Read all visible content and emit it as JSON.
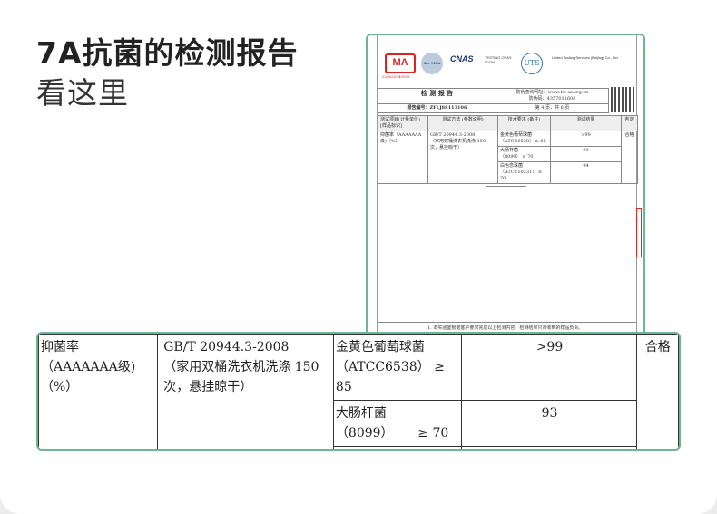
{
  "title": "7A抗菌的检测报告",
  "subtitle": "看这里",
  "doc": {
    "logos": {
      "ma": "MA",
      "ma_number": "220020349509",
      "ilac": "ilac-MRA",
      "cnas": "CNAS",
      "cnas_text": "TESTING CNAS L0784",
      "uts": "UTS",
      "uts_name": "United Testing Services (Beijing) Co., Ltd."
    },
    "header": {
      "title": "检 测 报 告",
      "query_url": "防伪查询网址：www.fcl-sz.org.cn",
      "code": "防伪码：4357011608",
      "report_no": "报告编号：ZFLJ88113106",
      "page": "第 4 页，共 6 页"
    },
    "columns": [
      "测试项目(计量单位) [样品标识]",
      "测试方法 (参数说明)",
      "技术要求 (备注)",
      "测试结果",
      "判定"
    ],
    "note": "1. 本实验室根据客户要求完成以上检测内容，检测结果只对收到的样品负责。"
  },
  "table": {
    "item": "抑菌率（AAAAAAA级)（%）",
    "method_line1": "GB/T 20944.3-2008",
    "method_line2": "（家用双桶洗衣机洗涤 150 次，悬挂晾干）",
    "verdict": "合格",
    "rows": [
      {
        "name": "金黄色葡萄球菌",
        "strain": "（ATCC6538）",
        "req": "≥ 85",
        "result": ">99"
      },
      {
        "name": "大肠杆菌",
        "strain": "（8099）",
        "req": "≥ 70",
        "result": "93"
      },
      {
        "name": "白色念珠菌",
        "strain": "（ATCC10231）",
        "req": "≥ 70",
        "result": "94"
      }
    ]
  }
}
